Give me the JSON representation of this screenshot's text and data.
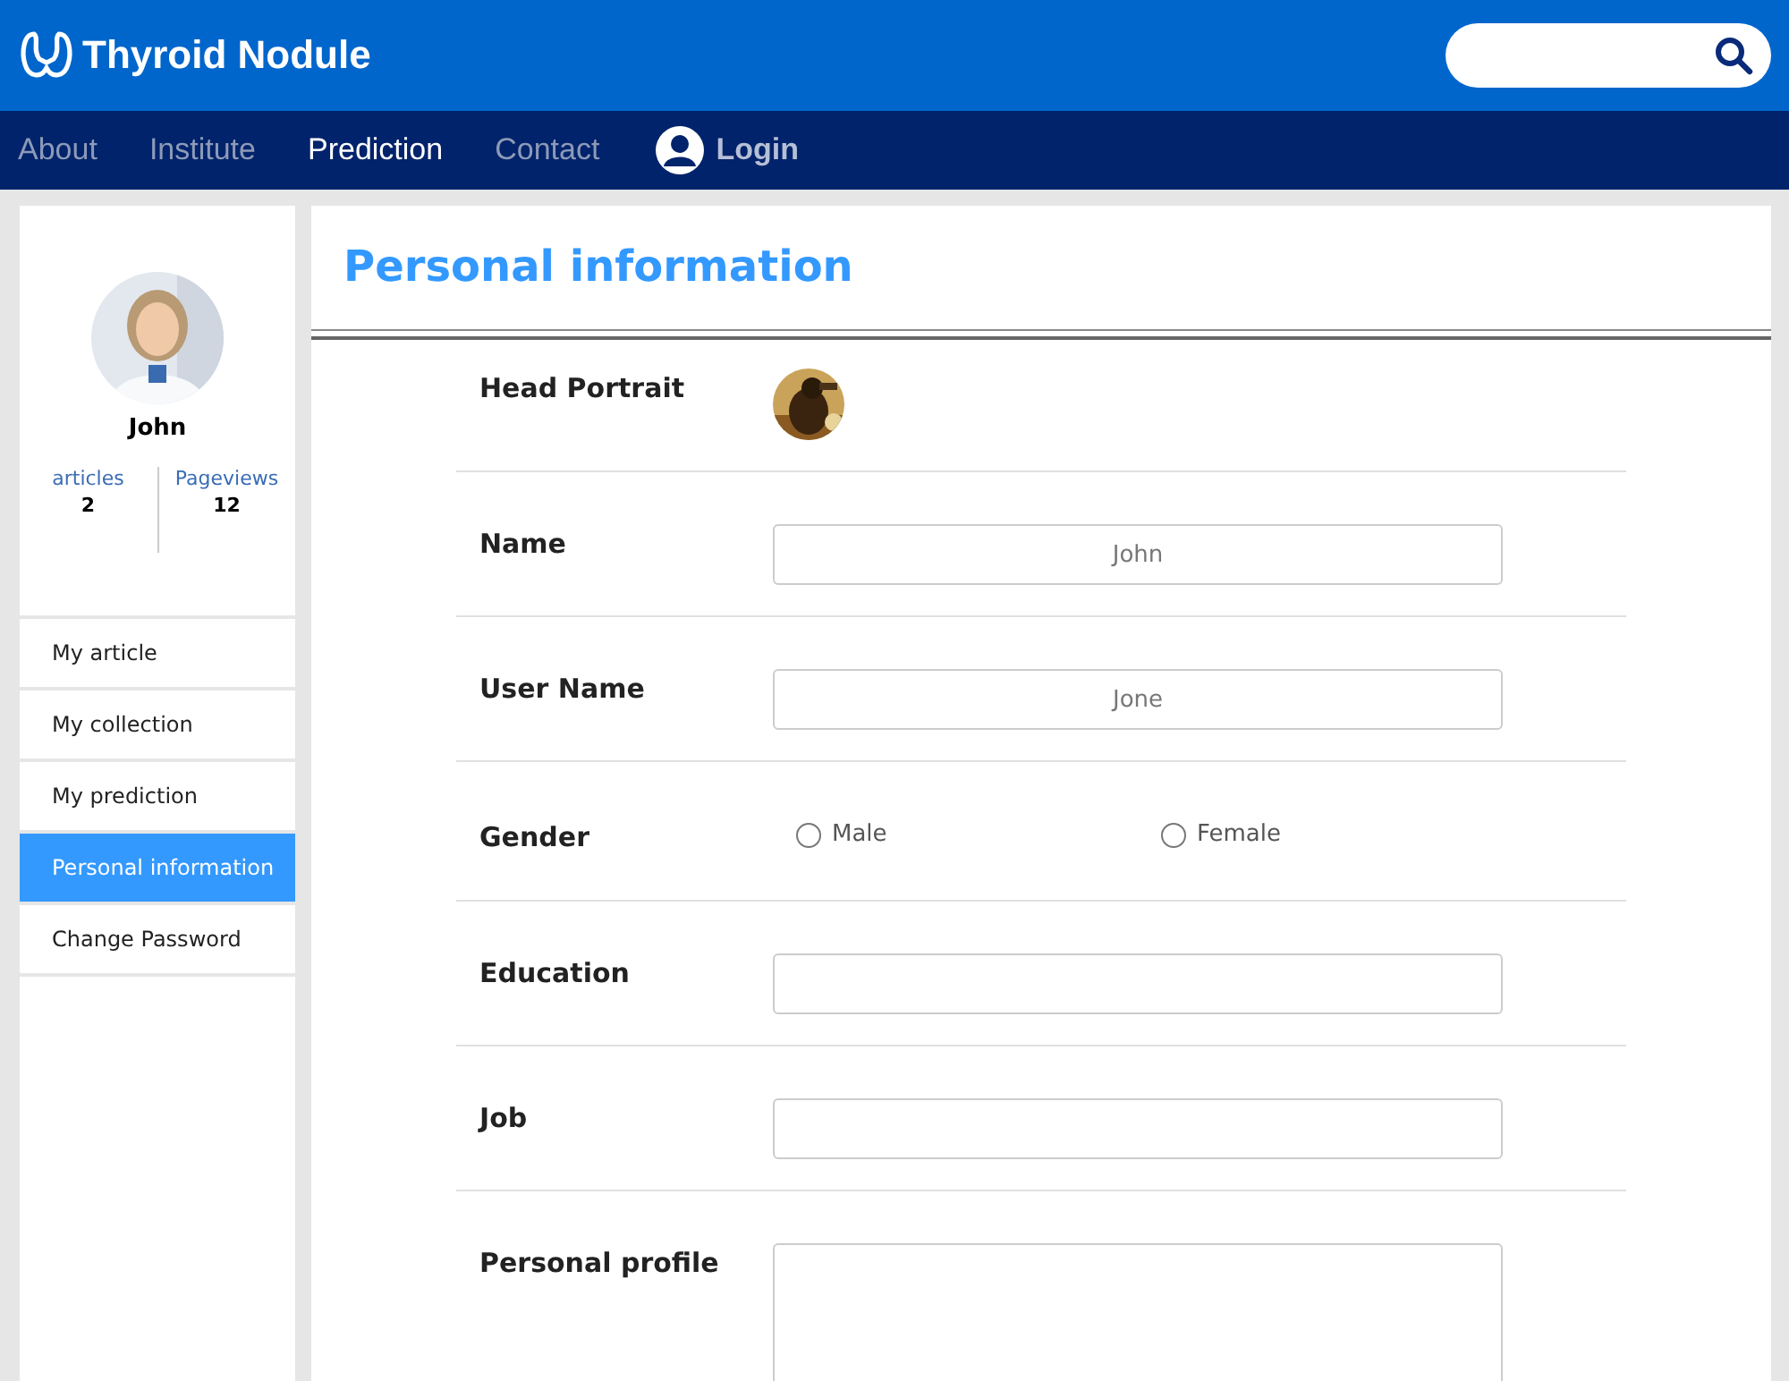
{
  "header": {
    "title": "Thyroid Nodule"
  },
  "nav": {
    "items": [
      {
        "label": "About",
        "selected": false
      },
      {
        "label": "Institute",
        "selected": false
      },
      {
        "label": "Prediction",
        "selected": true
      },
      {
        "label": "Contact",
        "selected": false
      }
    ],
    "login": "Login"
  },
  "profile": {
    "name": "John",
    "stats": [
      {
        "label": "articles",
        "value": "2"
      },
      {
        "label": "Pageviews",
        "value": "12"
      }
    ]
  },
  "sidebar": {
    "items": [
      {
        "label": "My article",
        "selected": false
      },
      {
        "label": "My collection",
        "selected": false
      },
      {
        "label": "My prediction",
        "selected": false
      },
      {
        "label": "Personal information",
        "selected": true
      },
      {
        "label": "Change Password",
        "selected": false
      }
    ]
  },
  "form": {
    "title": "Personal information",
    "rows": [
      {
        "kind": "portrait",
        "label": "Head Portrait"
      },
      {
        "kind": "text",
        "label": "Name",
        "placeholder": "John"
      },
      {
        "kind": "text",
        "label": "User Name",
        "placeholder": "Jone"
      },
      {
        "kind": "radio",
        "label": "Gender",
        "options": [
          {
            "label": "Male",
            "checked": false
          },
          {
            "label": "Female",
            "checked": false
          }
        ]
      },
      {
        "kind": "text",
        "label": "Education"
      },
      {
        "kind": "text",
        "label": "Job"
      },
      {
        "kind": "textarea",
        "label": "Personal profile"
      }
    ]
  }
}
